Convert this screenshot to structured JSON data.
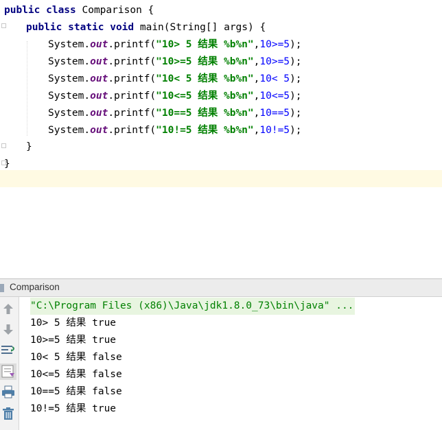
{
  "editor": {
    "lines": {
      "class_decl": {
        "kw": "public class",
        "rest": " Comparison {"
      },
      "main_decl": {
        "kw": "public static void",
        "rest": " main(String[] args) {"
      },
      "stmts": [
        {
          "obj": "System.",
          "fld": "out",
          "call": ".printf(",
          "str": "\"10> 5 结果 %b%n\"",
          "sep": ",",
          "expr": "10>=5",
          "end": ");"
        },
        {
          "obj": "System.",
          "fld": "out",
          "call": ".printf(",
          "str": "\"10>=5 结果 %b%n\"",
          "sep": ",",
          "expr": "10>=5",
          "end": ");"
        },
        {
          "obj": "System.",
          "fld": "out",
          "call": ".printf(",
          "str": "\"10< 5 结果 %b%n\"",
          "sep": ",",
          "expr": "10< 5",
          "end": ");"
        },
        {
          "obj": "System.",
          "fld": "out",
          "call": ".printf(",
          "str": "\"10<=5 结果 %b%n\"",
          "sep": ",",
          "expr": "10<=5",
          "end": ");"
        },
        {
          "obj": "System.",
          "fld": "out",
          "call": ".printf(",
          "str": "\"10==5 结果 %b%n\"",
          "sep": ",",
          "expr": "10==5",
          "end": ");"
        },
        {
          "obj": "System.",
          "fld": "out",
          "call": ".printf(",
          "str": "\"10!=5 结果 %b%n\"",
          "sep": ",",
          "expr": "10!=5",
          "end": ");"
        }
      ],
      "close_method": "}",
      "close_class": "}"
    }
  },
  "run_panel": {
    "title": "Comparison",
    "command": "\"C:\\Program Files (x86)\\Java\\jdk1.8.0_73\\bin\\java\" ...",
    "output": [
      "10> 5 结果 true",
      "10>=5 结果 true",
      "10< 5 结果 false",
      "10<=5 结果 false",
      "10==5 结果 false",
      "10!=5 结果 true"
    ],
    "toolbar": [
      "arrow-up-icon",
      "arrow-down-icon",
      "soft-wrap-icon",
      "scroll-to-end-icon",
      "print-icon",
      "trash-icon"
    ]
  },
  "colors": {
    "keyword": "#000080",
    "field": "#660e7a",
    "string": "#008000",
    "number": "#0000ff",
    "caret_row": "#fffae3"
  }
}
